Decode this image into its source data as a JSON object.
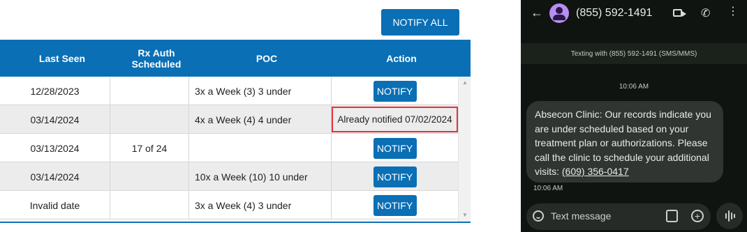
{
  "toolbar": {
    "notify_all_label": "NOTIFY ALL"
  },
  "table": {
    "headers": [
      "Last Seen",
      "Rx Auth Scheduled",
      "POC",
      "Action"
    ],
    "rows": [
      {
        "last_seen": "12/28/2023",
        "rx_auth": "",
        "poc": "3x a Week (3) 3 under",
        "action": "NOTIFY"
      },
      {
        "last_seen": "03/14/2024",
        "rx_auth": "",
        "poc": "4x a Week (4) 4 under",
        "action": "Already notified 07/02/2024"
      },
      {
        "last_seen": "03/13/2024",
        "rx_auth": "17 of 24",
        "poc": "",
        "action": "NOTIFY"
      },
      {
        "last_seen": "03/14/2024",
        "rx_auth": "",
        "poc": "10x a Week (10) 10 under",
        "action": "NOTIFY"
      },
      {
        "last_seen": "Invalid date",
        "rx_auth": "",
        "poc": "3x a Week (4) 3 under",
        "action": "NOTIFY"
      }
    ]
  },
  "phone": {
    "title": "(855) 592-1491",
    "texting_with": "Texting with (855) 592-1491 (SMS/MMS)",
    "timestamp_center": "10:06 AM",
    "message_text": "Absecon Clinic: Our records indicate you are under scheduled based on your treatment plan or authorizations. Please call the clinic to schedule your additional visits: ",
    "message_phone": "(609) 356-0417",
    "message_time": "10:06 AM",
    "compose_placeholder": "Text message",
    "icons": [
      "back-arrow-icon",
      "avatar",
      "video-call-icon",
      "phone-call-icon",
      "more-vert-icon",
      "emoji-icon",
      "gallery-icon",
      "add-icon",
      "voice-icon"
    ]
  },
  "colors": {
    "primary_blue": "#0a6fb5",
    "highlight_red": "#e0323a",
    "phone_bg": "#0f1410",
    "bubble_bg": "#303532",
    "avatar_purple": "#b78ef1"
  }
}
